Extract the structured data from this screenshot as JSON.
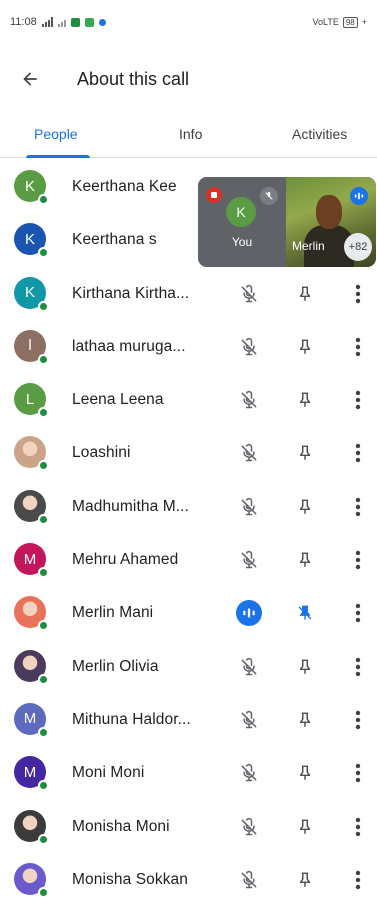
{
  "status_bar": {
    "time": "11:08",
    "network": "VoLTE",
    "battery": "98"
  },
  "header": {
    "title": "About this call"
  },
  "tabs": [
    {
      "label": "People",
      "active": true
    },
    {
      "label": "Info",
      "active": false
    },
    {
      "label": "Activities",
      "active": false
    }
  ],
  "colors": {
    "accent": "#1a73e8",
    "presence": "#1e8e3e",
    "record": "#d93025"
  },
  "participants": [
    {
      "name": "Keerthana Kee",
      "initial": "K",
      "avatar_color": "#5a9c43",
      "avatar_type": "letter",
      "mic": "muted",
      "pinned": false
    },
    {
      "name": "Keerthana s",
      "initial": "K",
      "avatar_color": "#1a56b0",
      "avatar_type": "letter",
      "mic": "muted",
      "pinned": false
    },
    {
      "name": "Kirthana Kirtha...",
      "initial": "K",
      "avatar_color": "#1297a6",
      "avatar_type": "letter",
      "mic": "muted",
      "pinned": false
    },
    {
      "name": "lathaa muruga...",
      "initial": "l",
      "avatar_color": "#8d6e63",
      "avatar_type": "letter",
      "mic": "muted",
      "pinned": false
    },
    {
      "name": "Leena Leena",
      "initial": "L",
      "avatar_color": "#5a9c43",
      "avatar_type": "letter",
      "mic": "muted",
      "pinned": false
    },
    {
      "name": "Loashini",
      "initial": "",
      "avatar_color": "#c9a48a",
      "avatar_type": "photo",
      "mic": "muted",
      "pinned": false
    },
    {
      "name": "Madhumitha M...",
      "initial": "",
      "avatar_color": "#4a4a4a",
      "avatar_type": "photo",
      "mic": "muted",
      "pinned": false
    },
    {
      "name": "Mehru Ahamed",
      "initial": "M",
      "avatar_color": "#c2185b",
      "avatar_type": "letter",
      "mic": "muted",
      "pinned": false
    },
    {
      "name": "Merlin Mani",
      "initial": "",
      "avatar_color": "#e8735a",
      "avatar_type": "photo",
      "mic": "speaking",
      "pinned": true
    },
    {
      "name": "Merlin Olivia",
      "initial": "",
      "avatar_color": "#4a3b5c",
      "avatar_type": "photo",
      "mic": "muted",
      "pinned": false
    },
    {
      "name": "Mithuna Haldor...",
      "initial": "M",
      "avatar_color": "#5c6bc0",
      "avatar_type": "letter",
      "mic": "muted",
      "pinned": false
    },
    {
      "name": "Moni Moni",
      "initial": "M",
      "avatar_color": "#4527a0",
      "avatar_type": "letter",
      "mic": "muted",
      "pinned": false
    },
    {
      "name": "Monisha Moni",
      "initial": "",
      "avatar_color": "#3b3b3b",
      "avatar_type": "photo",
      "mic": "muted",
      "pinned": false
    },
    {
      "name": "Monisha Sokkan",
      "initial": "",
      "avatar_color": "#6a5acd",
      "avatar_type": "photo",
      "mic": "muted",
      "pinned": false
    }
  ],
  "pip": {
    "self_initial": "K",
    "self_label": "You",
    "remote_label": "Merlin",
    "more_count": "+82"
  }
}
